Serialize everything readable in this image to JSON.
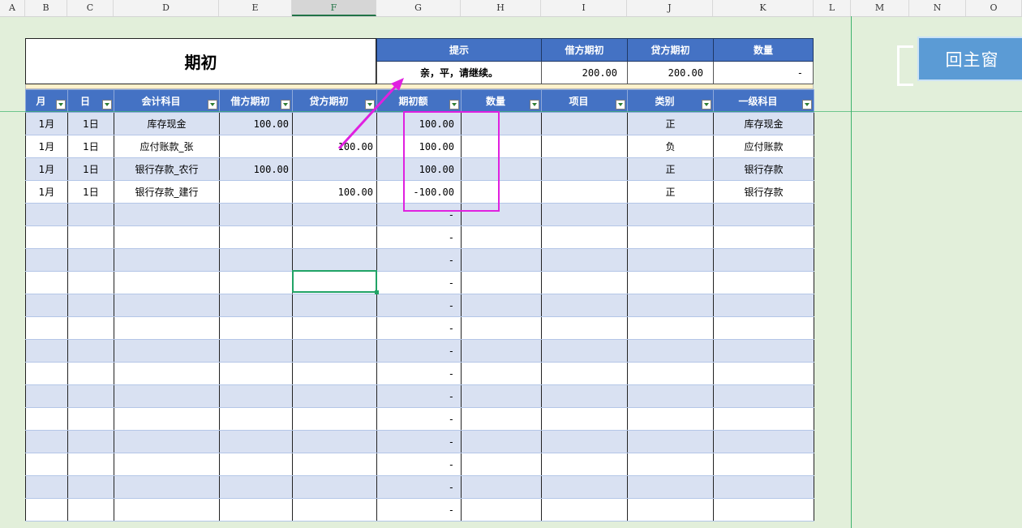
{
  "columns": [
    "A",
    "B",
    "C",
    "D",
    "E",
    "F",
    "G",
    "H",
    "I",
    "J",
    "K",
    "L",
    "M",
    "N",
    "O"
  ],
  "selected_column": "F",
  "title": "期初",
  "summary": {
    "headers": [
      "提示",
      "借方期初",
      "贷方期初",
      "数量"
    ],
    "values": [
      "亲，平，请继续。",
      "200.00",
      "200.00",
      "-"
    ]
  },
  "table": {
    "headers": [
      "月",
      "日",
      "会计科目",
      "借方期初",
      "贷方期初",
      "期初额",
      "数量",
      "项目",
      "类别",
      "一级科目"
    ],
    "rows": [
      [
        "1月",
        "1日",
        "库存现金",
        "100.00",
        "",
        "100.00",
        "",
        "",
        "正",
        "库存现金"
      ],
      [
        "1月",
        "1日",
        "应付账款_张",
        "",
        "100.00",
        "100.00",
        "",
        "",
        "负",
        "应付账款"
      ],
      [
        "1月",
        "1日",
        "银行存款_农行",
        "100.00",
        "",
        "100.00",
        "",
        "",
        "正",
        "银行存款"
      ],
      [
        "1月",
        "1日",
        "银行存款_建行",
        "",
        "100.00",
        "-100.00",
        "",
        "",
        "正",
        "银行存款"
      ],
      [
        "",
        "",
        "",
        "",
        "",
        "-",
        "",
        "",
        "",
        ""
      ],
      [
        "",
        "",
        "",
        "",
        "",
        "-",
        "",
        "",
        "",
        ""
      ],
      [
        "",
        "",
        "",
        "",
        "",
        "-",
        "",
        "",
        "",
        ""
      ],
      [
        "",
        "",
        "",
        "",
        "",
        "-",
        "",
        "",
        "",
        ""
      ],
      [
        "",
        "",
        "",
        "",
        "",
        "-",
        "",
        "",
        "",
        ""
      ],
      [
        "",
        "",
        "",
        "",
        "",
        "-",
        "",
        "",
        "",
        ""
      ],
      [
        "",
        "",
        "",
        "",
        "",
        "-",
        "",
        "",
        "",
        ""
      ],
      [
        "",
        "",
        "",
        "",
        "",
        "-",
        "",
        "",
        "",
        ""
      ],
      [
        "",
        "",
        "",
        "",
        "",
        "-",
        "",
        "",
        "",
        ""
      ],
      [
        "",
        "",
        "",
        "",
        "",
        "-",
        "",
        "",
        "",
        ""
      ],
      [
        "",
        "",
        "",
        "",
        "",
        "-",
        "",
        "",
        "",
        ""
      ],
      [
        "",
        "",
        "",
        "",
        "",
        "-",
        "",
        "",
        "",
        ""
      ],
      [
        "",
        "",
        "",
        "",
        "",
        "-",
        "",
        "",
        "",
        ""
      ],
      [
        "",
        "",
        "",
        "",
        "",
        "-",
        "",
        "",
        "",
        ""
      ]
    ]
  },
  "home_button": "回主窗",
  "colors": {
    "header_blue": "#4472c4",
    "band": "#d9e1f2",
    "highlight": "#e020e0",
    "sheet_bg": "#e2efda"
  },
  "icons": [
    "filter-dropdown-icon",
    "annotation-arrow-icon"
  ]
}
